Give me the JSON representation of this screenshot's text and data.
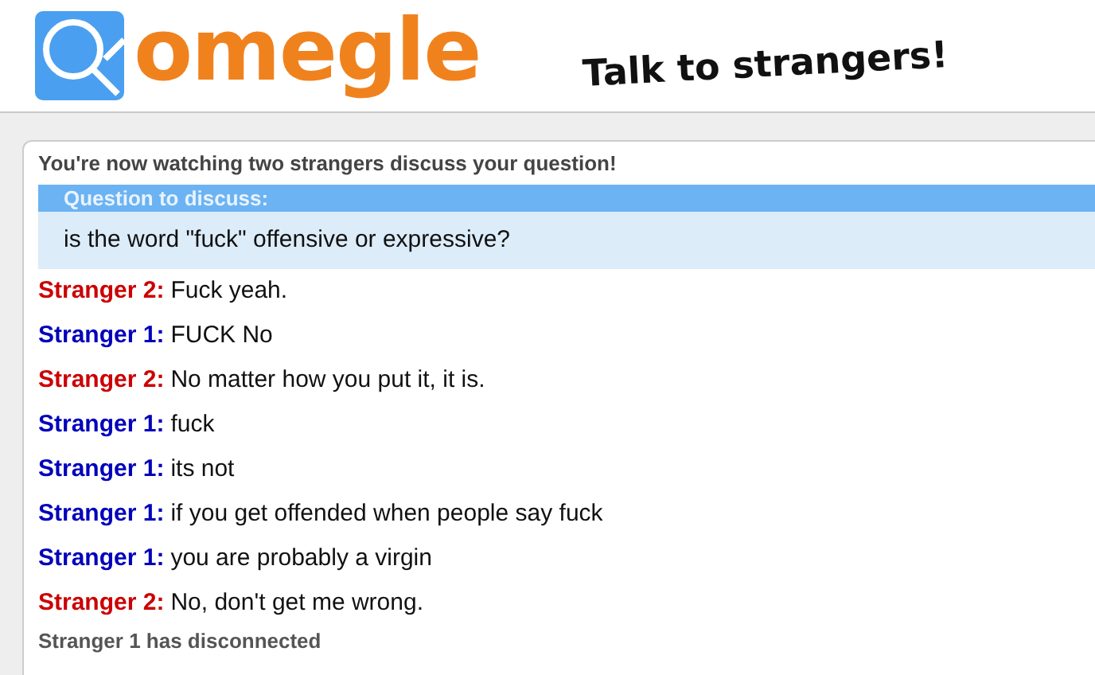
{
  "header": {
    "logo_text": "omegle",
    "tagline": "Talk to strangers!"
  },
  "status": "You're now watching two strangers discuss your question!",
  "question": {
    "heading": "Question to discuss:",
    "text": "is the word \"fuck\" offensive or expressive?"
  },
  "messages": [
    {
      "who": "Stranger 2:",
      "color": "#cc0000",
      "text": "Fuck yeah."
    },
    {
      "who": "Stranger 1:",
      "color": "#0000bb",
      "text": "FUCK No"
    },
    {
      "who": "Stranger 2:",
      "color": "#cc0000",
      "text": "No matter how you put it, it is."
    },
    {
      "who": "Stranger 1:",
      "color": "#0000bb",
      "text": "fuck"
    },
    {
      "who": "Stranger 1:",
      "color": "#0000bb",
      "text": "its not"
    },
    {
      "who": "Stranger 1:",
      "color": "#0000bb",
      "text": "if you get offended when people say fuck"
    },
    {
      "who": "Stranger 1:",
      "color": "#0000bb",
      "text": "you are probably a virgin"
    },
    {
      "who": "Stranger 2:",
      "color": "#cc0000",
      "text": "No, don't get me wrong."
    }
  ],
  "notice": "Stranger 1 has disconnected"
}
